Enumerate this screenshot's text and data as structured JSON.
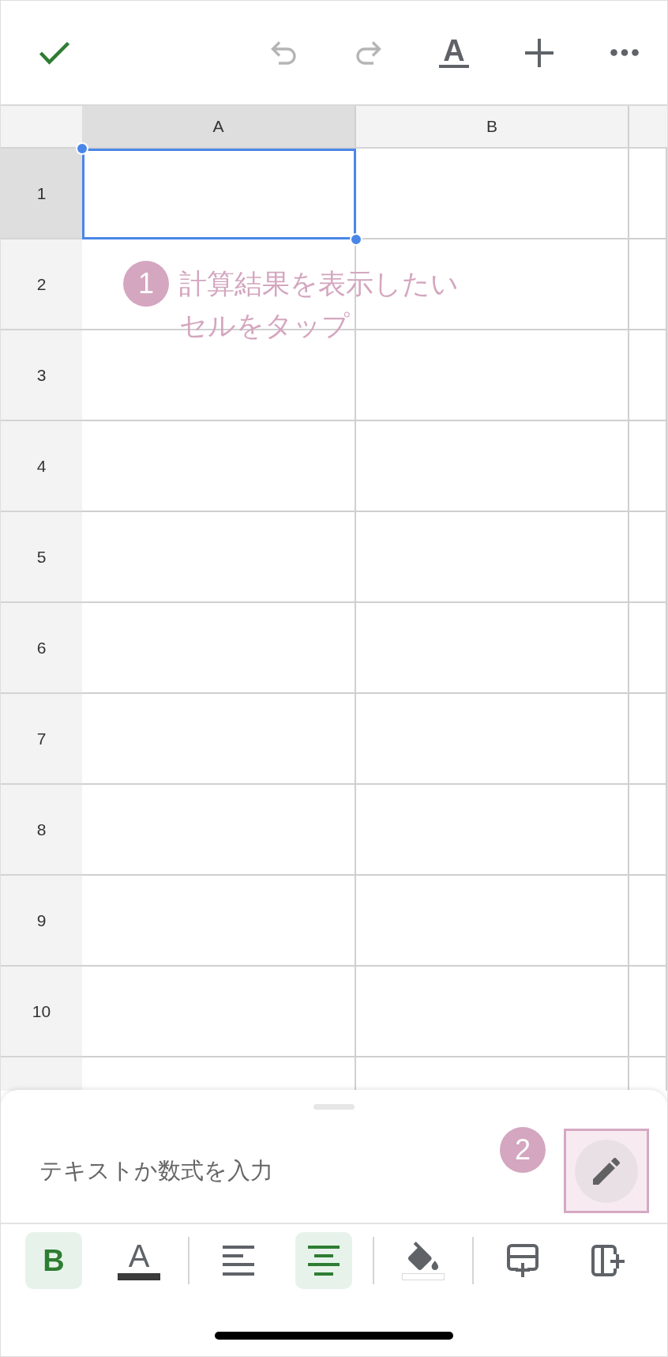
{
  "toolbar": [
    {
      "kind": "done",
      "disabled": false
    },
    {
      "kind": "undo",
      "disabled": true
    },
    {
      "kind": "redo",
      "disabled": true
    },
    {
      "kind": "text-format",
      "label": "A",
      "disabled": false
    },
    {
      "kind": "insert",
      "disabled": false
    },
    {
      "kind": "more",
      "disabled": false
    }
  ],
  "sheet": {
    "columns": [
      {
        "label": "A",
        "selected": true
      },
      {
        "label": "B",
        "selected": false
      }
    ],
    "rows": [
      {
        "label": "1",
        "selected": true
      },
      {
        "label": "2",
        "selected": false
      },
      {
        "label": "3",
        "selected": false
      },
      {
        "label": "4",
        "selected": false
      },
      {
        "label": "5",
        "selected": false
      },
      {
        "label": "6",
        "selected": false
      },
      {
        "label": "7",
        "selected": false
      },
      {
        "label": "8",
        "selected": false
      },
      {
        "label": "9",
        "selected": false
      },
      {
        "label": "10",
        "selected": false
      }
    ]
  },
  "annotations": [
    {
      "number": "1",
      "text": "計算結果を表示したいセルをタップ"
    },
    {
      "number": "2"
    }
  ],
  "formula_bar": {
    "placeholder": "テキストか数式を入力",
    "edit_button": {
      "highlighted": true
    }
  },
  "format_bar": {
    "groups": [
      [
        {
          "kind": "bold",
          "label": "B",
          "selected": true
        },
        {
          "kind": "text-color",
          "label": "A",
          "color": "#3c3c3c",
          "selected": false
        }
      ],
      [
        {
          "kind": "align-left",
          "selected": false
        },
        {
          "kind": "align-center",
          "selected": true
        }
      ],
      [
        {
          "kind": "fill-color",
          "color": "#ffffff",
          "selected": false
        }
      ],
      [
        {
          "kind": "insert-row",
          "selected": false
        },
        {
          "kind": "insert-column",
          "selected": false
        }
      ]
    ]
  }
}
